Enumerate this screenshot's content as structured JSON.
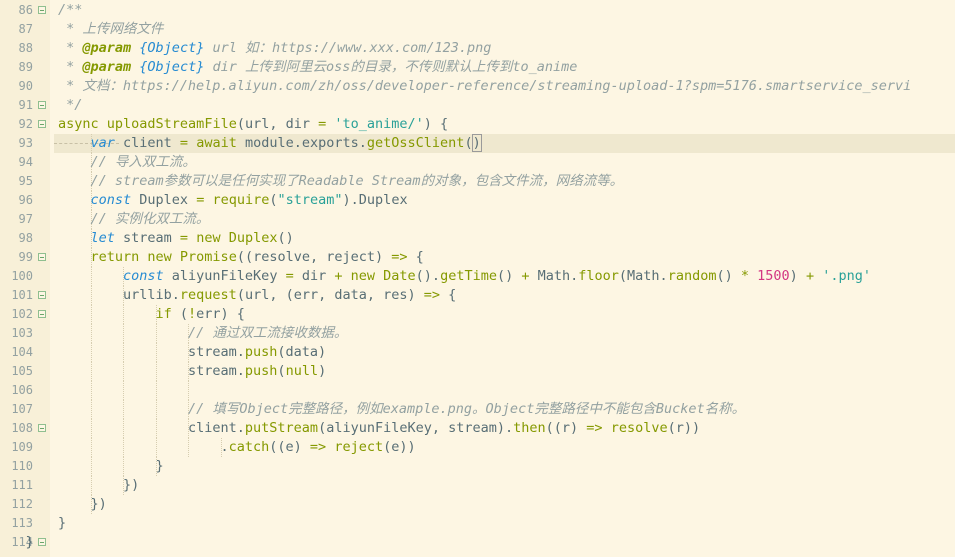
{
  "colors": {
    "background": "#fdf6e3",
    "comment": "#93a1a1",
    "keyword": "#859900",
    "string": "#2aa198",
    "function": "#859900",
    "number": "#d33682",
    "type": "#268bd2",
    "variable": "#586e75"
  },
  "current_line": 93,
  "lines": [
    {
      "n": "86",
      "fold": true,
      "indent": 1,
      "parts": [
        {
          "t": "/**",
          "c": "comment"
        }
      ]
    },
    {
      "n": "87",
      "fold": false,
      "indent": 1,
      "parts": [
        {
          "t": " * 上传网络文件",
          "c": "comment"
        }
      ]
    },
    {
      "n": "88",
      "fold": false,
      "indent": 1,
      "parts": [
        {
          "t": " * ",
          "c": "comment"
        },
        {
          "t": "@param",
          "c": "doctag"
        },
        {
          "t": " {Object}",
          "c": "doctype"
        },
        {
          "t": " url 如：https://www.xxx.com/123.png",
          "c": "comment"
        }
      ]
    },
    {
      "n": "89",
      "fold": false,
      "indent": 1,
      "parts": [
        {
          "t": " * ",
          "c": "comment"
        },
        {
          "t": "@param",
          "c": "doctag"
        },
        {
          "t": " {Object}",
          "c": "doctype"
        },
        {
          "t": " dir 上传到阿里云oss的目录，不传则默认上传到to_anime",
          "c": "comment"
        }
      ]
    },
    {
      "n": "90",
      "fold": false,
      "indent": 1,
      "parts": [
        {
          "t": " * 文档：https://help.aliyun.com/zh/oss/developer-reference/streaming-upload-1?spm=5176.smartservice_servi",
          "c": "comment"
        }
      ]
    },
    {
      "n": "91",
      "fold": true,
      "indent": 1,
      "parts": [
        {
          "t": " */",
          "c": "comment"
        }
      ]
    },
    {
      "n": "92",
      "fold": true,
      "indent": 1,
      "parts": [
        {
          "t": "async ",
          "c": "keyword"
        },
        {
          "t": "uploadStreamFile",
          "c": "function"
        },
        {
          "t": "(url, dir ",
          "c": "plain"
        },
        {
          "t": "=",
          "c": "operator"
        },
        {
          "t": " ",
          "c": "plain"
        },
        {
          "t": "'to_anime/'",
          "c": "string"
        },
        {
          "t": ") {",
          "c": "plain"
        }
      ]
    },
    {
      "n": "93",
      "fold": false,
      "indent": 2,
      "parts": [
        {
          "t": "var ",
          "c": "kwitalic"
        },
        {
          "t": "client ",
          "c": "plain"
        },
        {
          "t": "=",
          "c": "operator"
        },
        {
          "t": " ",
          "c": "plain"
        },
        {
          "t": "await ",
          "c": "keyword"
        },
        {
          "t": "module.exports.",
          "c": "plain"
        },
        {
          "t": "getOssClient",
          "c": "function"
        },
        {
          "t": "(",
          "c": "plain"
        },
        {
          "t": ")",
          "c": "cursor"
        }
      ]
    },
    {
      "n": "94",
      "fold": false,
      "indent": 2,
      "parts": [
        {
          "t": "// 导入双工流。",
          "c": "comment"
        }
      ]
    },
    {
      "n": "95",
      "fold": false,
      "indent": 2,
      "parts": [
        {
          "t": "// stream参数可以是任何实现了Readable Stream的对象，包含文件流，网络流等。",
          "c": "comment"
        }
      ]
    },
    {
      "n": "96",
      "fold": false,
      "indent": 2,
      "parts": [
        {
          "t": "const ",
          "c": "kwitalic"
        },
        {
          "t": "Duplex ",
          "c": "plain"
        },
        {
          "t": "=",
          "c": "operator"
        },
        {
          "t": " ",
          "c": "plain"
        },
        {
          "t": "require",
          "c": "function"
        },
        {
          "t": "(",
          "c": "plain"
        },
        {
          "t": "\"stream\"",
          "c": "string"
        },
        {
          "t": ").Duplex",
          "c": "plain"
        }
      ]
    },
    {
      "n": "97",
      "fold": false,
      "indent": 2,
      "parts": [
        {
          "t": "// 实例化双工流。",
          "c": "comment"
        }
      ]
    },
    {
      "n": "98",
      "fold": false,
      "indent": 2,
      "parts": [
        {
          "t": "let ",
          "c": "kwitalic"
        },
        {
          "t": "stream ",
          "c": "plain"
        },
        {
          "t": "=",
          "c": "operator"
        },
        {
          "t": " ",
          "c": "plain"
        },
        {
          "t": "new ",
          "c": "keyword"
        },
        {
          "t": "Duplex",
          "c": "function"
        },
        {
          "t": "()",
          "c": "plain"
        }
      ]
    },
    {
      "n": "99",
      "fold": true,
      "indent": 2,
      "parts": [
        {
          "t": "return ",
          "c": "keyword"
        },
        {
          "t": "new ",
          "c": "keyword"
        },
        {
          "t": "Promise",
          "c": "function"
        },
        {
          "t": "((resolve, reject) ",
          "c": "plain"
        },
        {
          "t": "=>",
          "c": "operator"
        },
        {
          "t": " {",
          "c": "plain"
        }
      ]
    },
    {
      "n": "100",
      "fold": false,
      "indent": 3,
      "parts": [
        {
          "t": "const ",
          "c": "kwitalic"
        },
        {
          "t": "aliyunFileKey ",
          "c": "plain"
        },
        {
          "t": "=",
          "c": "operator"
        },
        {
          "t": " dir ",
          "c": "plain"
        },
        {
          "t": "+",
          "c": "operator"
        },
        {
          "t": " ",
          "c": "plain"
        },
        {
          "t": "new ",
          "c": "keyword"
        },
        {
          "t": "Date",
          "c": "function"
        },
        {
          "t": "().",
          "c": "plain"
        },
        {
          "t": "getTime",
          "c": "function"
        },
        {
          "t": "() ",
          "c": "plain"
        },
        {
          "t": "+",
          "c": "operator"
        },
        {
          "t": " Math.",
          "c": "plain"
        },
        {
          "t": "floor",
          "c": "function"
        },
        {
          "t": "(Math.",
          "c": "plain"
        },
        {
          "t": "random",
          "c": "function"
        },
        {
          "t": "() ",
          "c": "plain"
        },
        {
          "t": "*",
          "c": "operator"
        },
        {
          "t": " ",
          "c": "plain"
        },
        {
          "t": "1500",
          "c": "number"
        },
        {
          "t": ") ",
          "c": "plain"
        },
        {
          "t": "+",
          "c": "operator"
        },
        {
          "t": " ",
          "c": "plain"
        },
        {
          "t": "'.png'",
          "c": "string"
        }
      ]
    },
    {
      "n": "101",
      "fold": true,
      "indent": 3,
      "parts": [
        {
          "t": "urllib.",
          "c": "plain"
        },
        {
          "t": "request",
          "c": "function"
        },
        {
          "t": "(url, (err, data, res) ",
          "c": "plain"
        },
        {
          "t": "=>",
          "c": "operator"
        },
        {
          "t": " {",
          "c": "plain"
        }
      ]
    },
    {
      "n": "102",
      "fold": true,
      "indent": 4,
      "parts": [
        {
          "t": "if ",
          "c": "keyword"
        },
        {
          "t": "(",
          "c": "plain"
        },
        {
          "t": "!",
          "c": "operator"
        },
        {
          "t": "err) {",
          "c": "plain"
        }
      ]
    },
    {
      "n": "103",
      "fold": false,
      "indent": 5,
      "parts": [
        {
          "t": "// 通过双工流接收数据。",
          "c": "comment"
        }
      ]
    },
    {
      "n": "104",
      "fold": false,
      "indent": 5,
      "parts": [
        {
          "t": "stream.",
          "c": "plain"
        },
        {
          "t": "push",
          "c": "function"
        },
        {
          "t": "(data)",
          "c": "plain"
        }
      ]
    },
    {
      "n": "105",
      "fold": false,
      "indent": 5,
      "parts": [
        {
          "t": "stream.",
          "c": "plain"
        },
        {
          "t": "push",
          "c": "function"
        },
        {
          "t": "(",
          "c": "plain"
        },
        {
          "t": "null",
          "c": "keyword"
        },
        {
          "t": ")",
          "c": "plain"
        }
      ]
    },
    {
      "n": "106",
      "fold": false,
      "indent": 5,
      "parts": []
    },
    {
      "n": "107",
      "fold": false,
      "indent": 5,
      "parts": [
        {
          "t": "// 填写Object完整路径，例如example.png。Object完整路径中不能包含Bucket名称。",
          "c": "comment"
        }
      ]
    },
    {
      "n": "108",
      "fold": true,
      "indent": 5,
      "parts": [
        {
          "t": "client.",
          "c": "plain"
        },
        {
          "t": "putStream",
          "c": "function"
        },
        {
          "t": "(aliyunFileKey, stream).",
          "c": "plain"
        },
        {
          "t": "then",
          "c": "function"
        },
        {
          "t": "((r) ",
          "c": "plain"
        },
        {
          "t": "=>",
          "c": "operator"
        },
        {
          "t": " ",
          "c": "plain"
        },
        {
          "t": "resolve",
          "c": "function"
        },
        {
          "t": "(r))",
          "c": "plain"
        }
      ]
    },
    {
      "n": "109",
      "fold": false,
      "indent": 6,
      "parts": [
        {
          "t": ".",
          "c": "plain"
        },
        {
          "t": "catch",
          "c": "function"
        },
        {
          "t": "((e) ",
          "c": "plain"
        },
        {
          "t": "=>",
          "c": "operator"
        },
        {
          "t": " ",
          "c": "plain"
        },
        {
          "t": "reject",
          "c": "function"
        },
        {
          "t": "(e))",
          "c": "plain"
        }
      ]
    },
    {
      "n": "110",
      "fold": false,
      "indent": 4,
      "parts": [
        {
          "t": "}",
          "c": "plain"
        }
      ]
    },
    {
      "n": "111",
      "fold": false,
      "indent": 3,
      "parts": [
        {
          "t": "})",
          "c": "plain"
        }
      ]
    },
    {
      "n": "112",
      "fold": false,
      "indent": 2,
      "parts": [
        {
          "t": "})",
          "c": "plain"
        }
      ]
    },
    {
      "n": "113",
      "fold": false,
      "indent": 1,
      "parts": [
        {
          "t": "}",
          "c": "plain"
        }
      ]
    },
    {
      "n": "114",
      "fold": true,
      "indent": 0,
      "parts": [
        {
          "t": "}",
          "c": "plain"
        }
      ]
    }
  ]
}
